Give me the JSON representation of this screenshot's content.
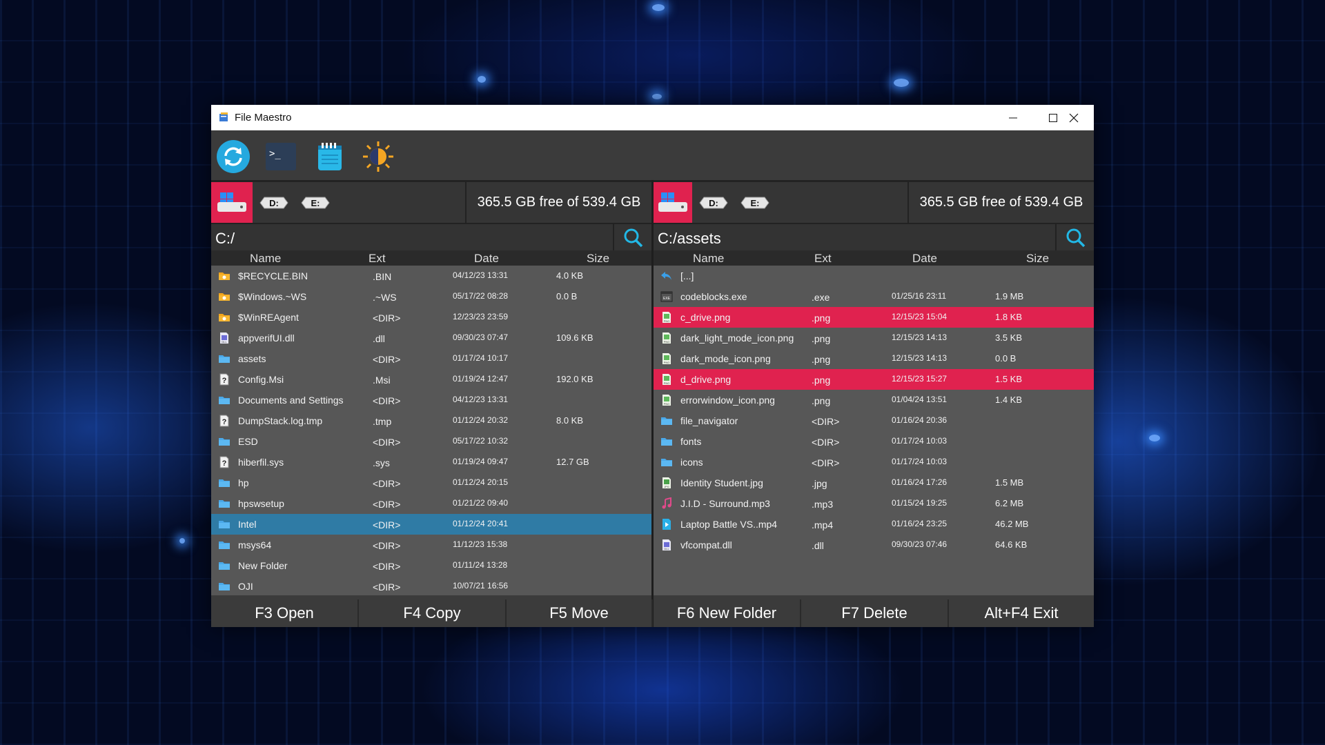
{
  "window": {
    "title": "File Maestro"
  },
  "toolbar": [
    {
      "name": "refresh-icon"
    },
    {
      "name": "terminal-icon"
    },
    {
      "name": "notepad-icon"
    },
    {
      "name": "theme-toggle-icon"
    }
  ],
  "left_panel": {
    "drives": [
      "C",
      "D:",
      "E:"
    ],
    "free_space": "365.5 GB free of 539.4 GB",
    "path": "C:/",
    "headers": {
      "name": "Name",
      "ext": "Ext",
      "date": "Date",
      "size": "Size"
    },
    "files": [
      {
        "name": "$RECYCLE.BIN",
        "ext": ".BIN",
        "date": "04/12/23 13:31",
        "size": "4.0 KB",
        "icon": "system-folder-icon",
        "state": ""
      },
      {
        "name": "$Windows.~WS",
        "ext": ".~WS",
        "date": "05/17/22 08:28",
        "size": "0.0 B",
        "icon": "system-folder-icon",
        "state": ""
      },
      {
        "name": "$WinREAgent",
        "ext": "<DIR>",
        "date": "12/23/23 23:59",
        "size": "",
        "icon": "system-folder-icon",
        "state": ""
      },
      {
        "name": "appverifUI.dll",
        "ext": ".dll",
        "date": "09/30/23 07:47",
        "size": "109.6 KB",
        "icon": "dll-icon",
        "state": ""
      },
      {
        "name": "assets",
        "ext": "<DIR>",
        "date": "01/17/24 10:17",
        "size": "",
        "icon": "folder-icon",
        "state": ""
      },
      {
        "name": "Config.Msi",
        "ext": ".Msi",
        "date": "01/19/24 12:47",
        "size": "192.0 KB",
        "icon": "unknown-file-icon",
        "state": ""
      },
      {
        "name": "Documents and Settings",
        "ext": "<DIR>",
        "date": "04/12/23 13:31",
        "size": "",
        "icon": "folder-icon",
        "state": ""
      },
      {
        "name": "DumpStack.log.tmp",
        "ext": ".tmp",
        "date": "01/12/24 20:32",
        "size": "8.0 KB",
        "icon": "unknown-file-icon",
        "state": ""
      },
      {
        "name": "ESD",
        "ext": "<DIR>",
        "date": "05/17/22 10:32",
        "size": "",
        "icon": "folder-icon",
        "state": ""
      },
      {
        "name": "hiberfil.sys",
        "ext": ".sys",
        "date": "01/19/24 09:47",
        "size": "12.7 GB",
        "icon": "unknown-file-icon",
        "state": ""
      },
      {
        "name": "hp",
        "ext": "<DIR>",
        "date": "01/12/24 20:15",
        "size": "",
        "icon": "folder-icon",
        "state": ""
      },
      {
        "name": "hpswsetup",
        "ext": "<DIR>",
        "date": "01/21/22 09:40",
        "size": "",
        "icon": "folder-icon",
        "state": ""
      },
      {
        "name": "Intel",
        "ext": "<DIR>",
        "date": "01/12/24 20:41",
        "size": "",
        "icon": "folder-icon",
        "state": "blue"
      },
      {
        "name": "msys64",
        "ext": "<DIR>",
        "date": "11/12/23 15:38",
        "size": "",
        "icon": "folder-icon",
        "state": ""
      },
      {
        "name": "New Folder",
        "ext": "<DIR>",
        "date": "01/11/24 13:28",
        "size": "",
        "icon": "folder-icon",
        "state": ""
      },
      {
        "name": "OJI",
        "ext": "<DIR>",
        "date": "10/07/21 16:56",
        "size": "",
        "icon": "folder-icon",
        "state": ""
      }
    ]
  },
  "right_panel": {
    "drives": [
      "C",
      "D:",
      "E:"
    ],
    "free_space": "365.5 GB free of 539.4 GB",
    "path": "C:/assets",
    "headers": {
      "name": "Name",
      "ext": "Ext",
      "date": "Date",
      "size": "Size"
    },
    "files": [
      {
        "name": "[...]",
        "ext": "",
        "date": "",
        "size": "",
        "icon": "back-arrow-icon",
        "state": ""
      },
      {
        "name": "codeblocks.exe",
        "ext": ".exe",
        "date": "01/25/16 23:11",
        "size": "1.9 MB",
        "icon": "exe-icon",
        "state": ""
      },
      {
        "name": "c_drive.png",
        "ext": ".png",
        "date": "12/15/23 15:04",
        "size": "1.8 KB",
        "icon": "png-icon",
        "state": "red"
      },
      {
        "name": "dark_light_mode_icon.png",
        "ext": ".png",
        "date": "12/15/23 14:13",
        "size": "3.5 KB",
        "icon": "png-icon",
        "state": ""
      },
      {
        "name": "dark_mode_icon.png",
        "ext": ".png",
        "date": "12/15/23 14:13",
        "size": "0.0 B",
        "icon": "png-icon",
        "state": ""
      },
      {
        "name": "d_drive.png",
        "ext": ".png",
        "date": "12/15/23 15:27",
        "size": "1.5 KB",
        "icon": "png-icon",
        "state": "red"
      },
      {
        "name": "errorwindow_icon.png",
        "ext": ".png",
        "date": "01/04/24 13:51",
        "size": "1.4 KB",
        "icon": "png-icon",
        "state": ""
      },
      {
        "name": "file_navigator",
        "ext": "<DIR>",
        "date": "01/16/24 20:36",
        "size": "",
        "icon": "folder-icon",
        "state": ""
      },
      {
        "name": "fonts",
        "ext": "<DIR>",
        "date": "01/17/24 10:03",
        "size": "",
        "icon": "folder-icon",
        "state": ""
      },
      {
        "name": "icons",
        "ext": "<DIR>",
        "date": "01/17/24 10:03",
        "size": "",
        "icon": "folder-icon",
        "state": ""
      },
      {
        "name": "Identity Student.jpg",
        "ext": ".jpg",
        "date": "01/16/24 17:26",
        "size": "1.5 MB",
        "icon": "jpg-icon",
        "state": ""
      },
      {
        "name": "J.I.D - Surround.mp3",
        "ext": ".mp3",
        "date": "01/15/24 19:25",
        "size": "6.2 MB",
        "icon": "music-icon",
        "state": ""
      },
      {
        "name": "Laptop Battle VS..mp4",
        "ext": ".mp4",
        "date": "01/16/24 23:25",
        "size": "46.2 MB",
        "icon": "video-icon",
        "state": ""
      },
      {
        "name": "vfcompat.dll",
        "ext": ".dll",
        "date": "09/30/23 07:46",
        "size": "64.6 KB",
        "icon": "dll-icon",
        "state": ""
      }
    ]
  },
  "function_keys": [
    "F3 Open",
    "F4 Copy",
    "F5 Move",
    "F6 New Folder",
    "F7 Delete",
    "Alt+F4 Exit"
  ],
  "colors": {
    "accent_red": "#e0224f",
    "selection_blue": "#2f7ba5",
    "search_cyan": "#22b8e6"
  }
}
